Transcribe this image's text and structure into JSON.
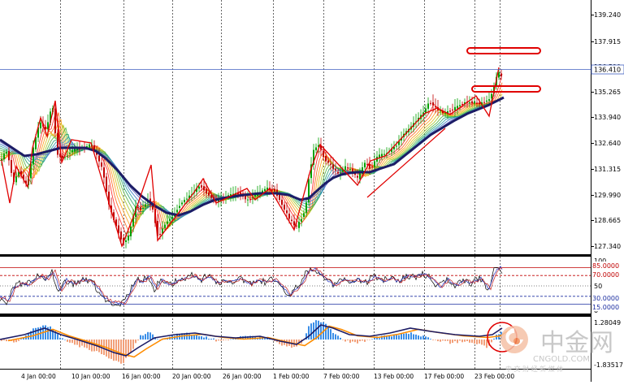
{
  "main_chart": {
    "price_axis": [
      "139.240",
      "137.915",
      "136.590",
      "135.265",
      "133.940",
      "132.640",
      "131.315",
      "129.990",
      "128.665",
      "127.340"
    ],
    "current_price": "136.410"
  },
  "oscillator": {
    "axis": [
      "100",
      "50",
      "0"
    ],
    "levels": [
      "85.0000",
      "70.0000",
      "30.0000",
      "15.0000"
    ]
  },
  "macd": {
    "axis": [
      "1.28049",
      "-1.83517"
    ]
  },
  "time_axis": [
    "4 Jan 00:00",
    "10 Jan 00:00",
    "16 Jan 00:00",
    "20 Jan 00:00",
    "26 Jan 00:00",
    "1 Feb 00:00",
    "7 Feb 00:00",
    "13 Feb 00:00",
    "17 Feb 00:00",
    "23 Feb 00:00"
  ],
  "watermark": {
    "chinese": "中金网",
    "domain": "CNGOLD.COM",
    "tagline": "中 文 财 经 新 媒 体"
  },
  "colors": {
    "bull": "#00a000",
    "bear": "#c00000",
    "ma_thick": "#1c1c66",
    "zigzag": "#e00000",
    "price_line": "#4060c0",
    "macd_pos": "#3a8ee8",
    "macd_neg": "#f2a07a",
    "signal": "#ff8c00"
  }
}
